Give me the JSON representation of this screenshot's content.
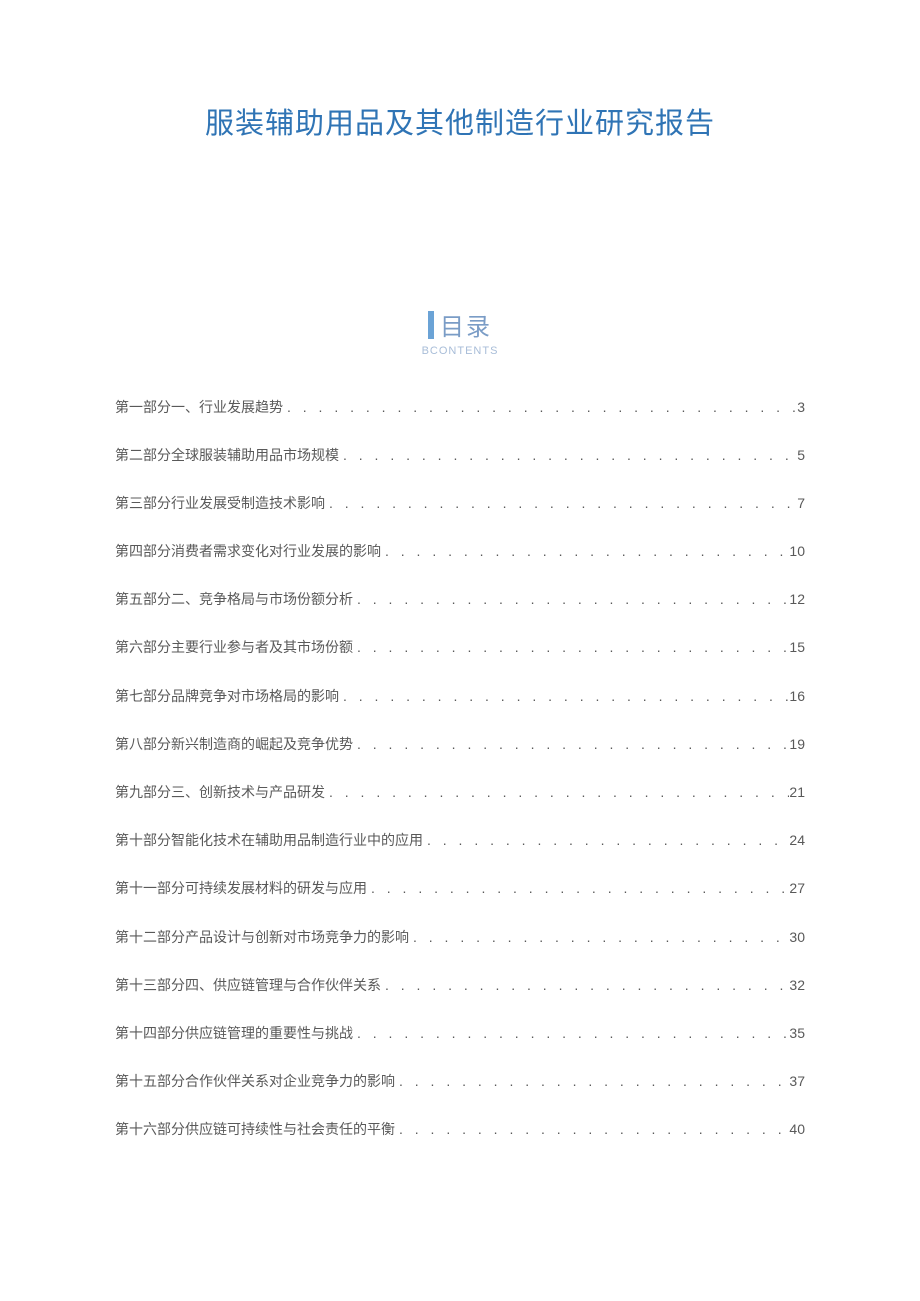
{
  "title": "服装辅助用品及其他制造行业研究报告",
  "toc_header": {
    "title": "目录",
    "subtitle": "BCONTENTS"
  },
  "entries": [
    {
      "text": "第一部分一、行业发展趋势",
      "page": "3"
    },
    {
      "text": "第二部分全球服装辅助用品市场规模",
      "page": "5"
    },
    {
      "text": "第三部分行业发展受制造技术影响",
      "page": "7"
    },
    {
      "text": "第四部分消费者需求变化对行业发展的影响",
      "page": "10"
    },
    {
      "text": "第五部分二、竞争格局与市场份额分析",
      "page": "12"
    },
    {
      "text": "第六部分主要行业参与者及其市场份额",
      "page": "15"
    },
    {
      "text": "第七部分品牌竞争对市场格局的影响",
      "page": "16"
    },
    {
      "text": "第八部分新兴制造商的崛起及竞争优势",
      "page": "19"
    },
    {
      "text": "第九部分三、创新技术与产品研发",
      "page": "21"
    },
    {
      "text": "第十部分智能化技术在辅助用品制造行业中的应用",
      "page": "24"
    },
    {
      "text": "第十一部分可持续发展材料的研发与应用",
      "page": "27"
    },
    {
      "text": "第十二部分产品设计与创新对市场竞争力的影响",
      "page": "30"
    },
    {
      "text": "第十三部分四、供应链管理与合作伙伴关系",
      "page": "32"
    },
    {
      "text": "第十四部分供应链管理的重要性与挑战",
      "page": "35"
    },
    {
      "text": "第十五部分合作伙伴关系对企业竞争力的影响",
      "page": "37"
    },
    {
      "text": "第十六部分供应链可持续性与社会责任的平衡",
      "page": "40"
    }
  ]
}
